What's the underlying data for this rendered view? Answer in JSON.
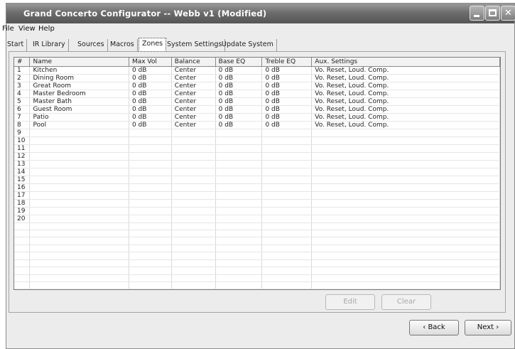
{
  "window": {
    "title": "Grand Concerto Configurator -- Webb v1 (Modified)"
  },
  "menu": {
    "file": "File",
    "view": "View",
    "help": "Help"
  },
  "tabs": [
    {
      "label": "Start",
      "active": false
    },
    {
      "label": "IR Library",
      "active": false
    },
    {
      "label": "Sources",
      "active": false
    },
    {
      "label": "Macros",
      "active": false
    },
    {
      "label": "Zones",
      "active": true
    },
    {
      "label": "System Settings",
      "active": false
    },
    {
      "label": "Update System",
      "active": false
    }
  ],
  "table": {
    "columns": [
      "#",
      "Name",
      "Max Vol",
      "Balance",
      "Base EQ",
      "Treble EQ",
      "Aux. Settings"
    ],
    "rows": [
      [
        "1",
        "Kitchen",
        "0 dB",
        "Center",
        "0 dB",
        "0 dB",
        "Vo. Reset, Loud. Comp."
      ],
      [
        "2",
        "Dining Room",
        "0 dB",
        "Center",
        "0 dB",
        "0 dB",
        "Vo. Reset, Loud. Comp."
      ],
      [
        "3",
        "Great Room",
        "0 dB",
        "Center",
        "0 dB",
        "0 dB",
        "Vo. Reset, Loud. Comp."
      ],
      [
        "4",
        "Master Bedroom",
        "0 dB",
        "Center",
        "0 dB",
        "0 dB",
        "Vo. Reset, Loud. Comp."
      ],
      [
        "5",
        "Master Bath",
        "0 dB",
        "Center",
        "0 dB",
        "0 dB",
        "Vo. Reset, Loud. Comp."
      ],
      [
        "6",
        "Guest Room",
        "0 dB",
        "Center",
        "0 dB",
        "0 dB",
        "Vo. Reset, Loud. Comp."
      ],
      [
        "7",
        "Patio",
        "0 dB",
        "Center",
        "0 dB",
        "0 dB",
        "Vo. Reset, Loud. Comp."
      ],
      [
        "8",
        "Pool",
        "0 dB",
        "Center",
        "0 dB",
        "0 dB",
        "Vo. Reset, Loud. Comp."
      ],
      [
        "9",
        "",
        "",
        "",
        "",
        "",
        ""
      ],
      [
        "10",
        "",
        "",
        "",
        "",
        "",
        ""
      ],
      [
        "11",
        "",
        "",
        "",
        "",
        "",
        ""
      ],
      [
        "12",
        "",
        "",
        "",
        "",
        "",
        ""
      ],
      [
        "13",
        "",
        "",
        "",
        "",
        "",
        ""
      ],
      [
        "14",
        "",
        "",
        "",
        "",
        "",
        ""
      ],
      [
        "15",
        "",
        "",
        "",
        "",
        "",
        ""
      ],
      [
        "16",
        "",
        "",
        "",
        "",
        "",
        ""
      ],
      [
        "17",
        "",
        "",
        "",
        "",
        "",
        ""
      ],
      [
        "18",
        "",
        "",
        "",
        "",
        "",
        ""
      ],
      [
        "19",
        "",
        "",
        "",
        "",
        "",
        ""
      ],
      [
        "20",
        "",
        "",
        "",
        "",
        "",
        ""
      ],
      [
        "",
        "",
        "",
        "",
        "",
        "",
        ""
      ],
      [
        "",
        "",
        "",
        "",
        "",
        "",
        ""
      ],
      [
        "",
        "",
        "",
        "",
        "",
        "",
        ""
      ],
      [
        "",
        "",
        "",
        "",
        "",
        "",
        ""
      ],
      [
        "",
        "",
        "",
        "",
        "",
        "",
        ""
      ],
      [
        "",
        "",
        "",
        "",
        "",
        "",
        ""
      ],
      [
        "",
        "",
        "",
        "",
        "",
        "",
        ""
      ],
      [
        "",
        "",
        "",
        "",
        "",
        "",
        ""
      ],
      [
        "",
        "",
        "",
        "",
        "",
        "",
        ""
      ]
    ]
  },
  "buttons": {
    "edit": "Edit",
    "clear": "Clear",
    "back": "‹ Back",
    "next": "Next ›"
  }
}
